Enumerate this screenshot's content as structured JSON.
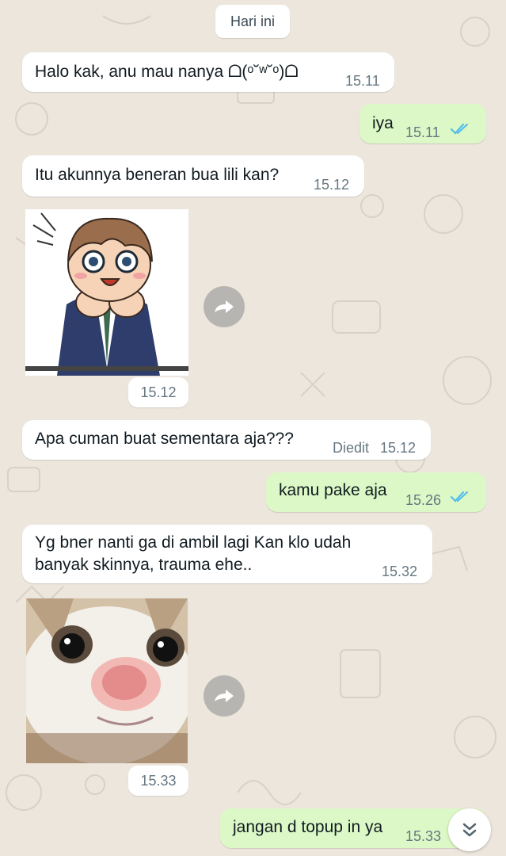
{
  "date_chip": "Hari ini",
  "messages": [
    {
      "direction": "incoming",
      "text": "Halo kak, anu mau nanya ᗝ(ᵒ˘ʷ˘ᵒ)ᗝ",
      "time": "15.11"
    },
    {
      "direction": "outgoing",
      "text": "iya",
      "time": "15.11",
      "status": "read"
    },
    {
      "direction": "incoming",
      "text": "Itu akunnya beneran bua lili kan?",
      "time": "15.12"
    },
    {
      "direction": "incoming",
      "type": "sticker",
      "sticker": "anime-boy-sticker",
      "time": "15.12"
    },
    {
      "direction": "incoming",
      "text": "Apa cuman buat sementara aja???",
      "edited_label": "Diedit",
      "time": "15.12"
    },
    {
      "direction": "outgoing",
      "text": "kamu pake aja",
      "time": "15.26",
      "status": "read"
    },
    {
      "direction": "incoming",
      "lines": [
        "Yg bner nanti ga di ambil lagi Kan klo udah",
        "banyak skinnya, trauma ehe.."
      ],
      "time": "15.32"
    },
    {
      "direction": "incoming",
      "type": "sticker",
      "sticker": "cat-face-sticker",
      "time": "15.33"
    },
    {
      "direction": "outgoing",
      "text": "jangan d topup in ya",
      "time": "15.33"
    }
  ],
  "colors": {
    "wallpaper": "#ede6dd",
    "incoming_bubble": "#ffffff",
    "outgoing_bubble": "#dcf8c6",
    "read_ticks": "#53bdeb",
    "timestamp": "#667781"
  },
  "icons": {
    "forward": "forward-icon",
    "read_status": "double-check-icon",
    "scroll_down": "double-chevron-down-icon"
  }
}
